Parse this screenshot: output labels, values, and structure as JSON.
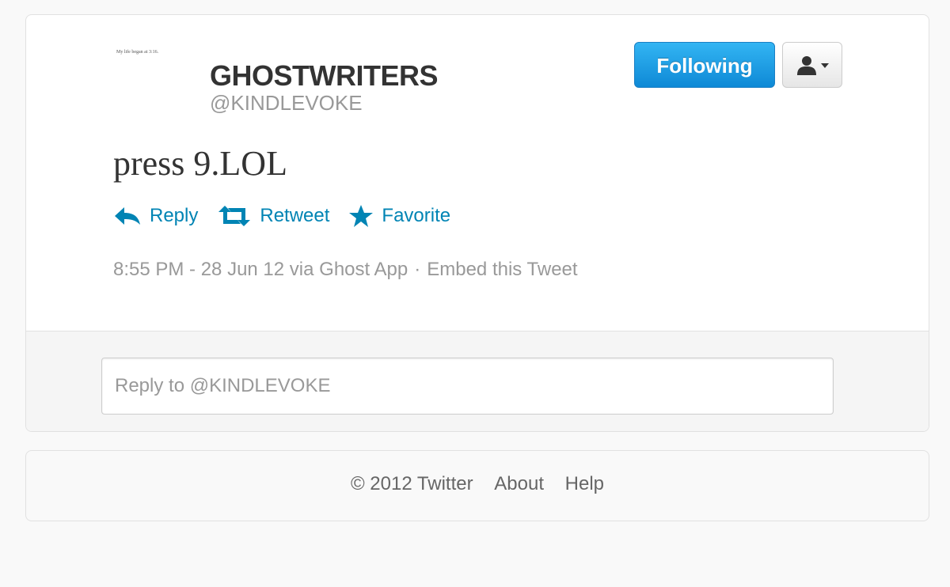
{
  "user": {
    "display_name": "GHOSTWRITERS",
    "screen_name": "@KINDLEVOKE",
    "avatar_text": "My life began at 3:16."
  },
  "buttons": {
    "following": "Following",
    "user_menu_icon": "person-dropdown-icon"
  },
  "tweet": {
    "text": "press 9.LOL",
    "actions": [
      {
        "label": "Reply",
        "icon": "reply-arrow-icon"
      },
      {
        "label": "Retweet",
        "icon": "retweet-icon"
      },
      {
        "label": "Favorite",
        "icon": "star-icon"
      }
    ],
    "timestamp": "8:55 PM - 28 Jun 12 via Ghost App",
    "separator": "·",
    "embed_label": "Embed this Tweet"
  },
  "reply": {
    "placeholder": "Reply to @KINDLEVOKE"
  },
  "footer": {
    "copyright": "© 2012 Twitter",
    "links": [
      "About",
      "Help"
    ]
  },
  "colors": {
    "link_blue": "#0084b4",
    "button_blue": "#1a9ee4",
    "muted_text": "#999999"
  }
}
